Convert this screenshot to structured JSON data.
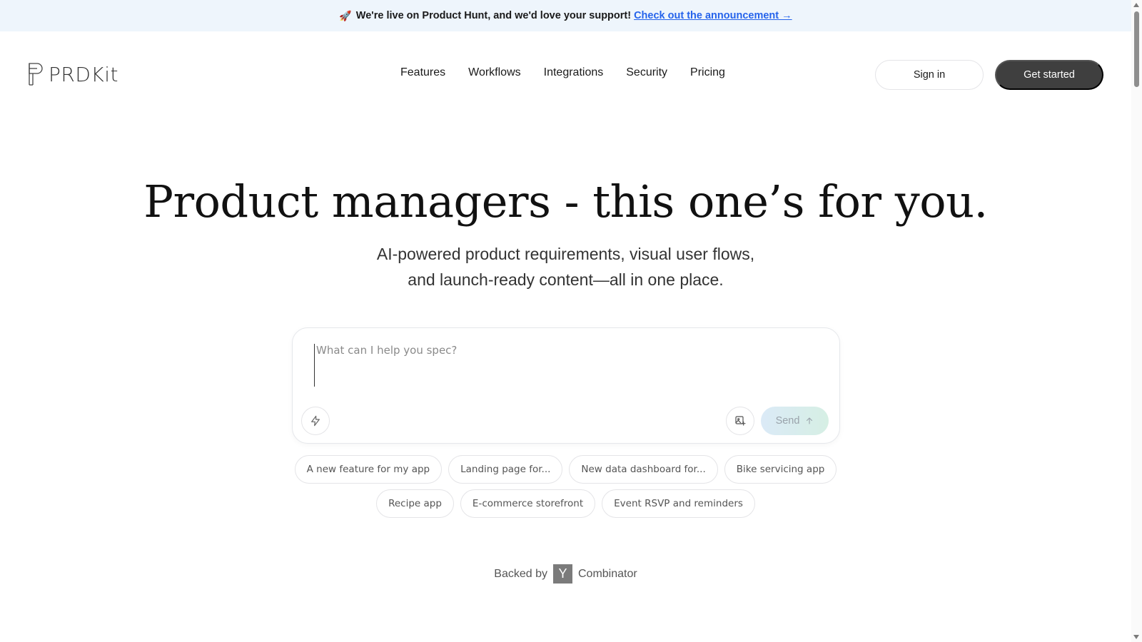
{
  "banner": {
    "text": "We're live on Product Hunt, and we'd love your support!",
    "link": "Check out the announcement →"
  },
  "header": {
    "logo": "PRDKit",
    "nav": [
      "Features",
      "Workflows",
      "Integrations",
      "Security",
      "Pricing"
    ],
    "sign_in": "Sign in",
    "get_started": "Get started"
  },
  "hero": {
    "title": "Product managers - this one’s for you.",
    "subtitle_line1": "AI-powered product requirements, visual user flows,",
    "subtitle_line2": "and launch-ready content—all in one place."
  },
  "prompt": {
    "placeholder": "What can I help you spec?",
    "send_label": "Send"
  },
  "suggestions": [
    "A new feature for my app",
    "Landing page for...",
    "New data dashboard for...",
    "Bike servicing app",
    "Recipe app",
    "E-commerce storefront",
    "Event RSVP and reminders"
  ],
  "backed": {
    "prefix": "Backed by",
    "logo_letter": "Y",
    "name": "Combinator"
  },
  "icons": {
    "banner": "rocket-icon",
    "logo": "prdkit-logo-icon",
    "quick": "lightning-icon",
    "attach": "image-add-icon",
    "send": "arrow-up-icon"
  },
  "colors": {
    "banner_bg": "#eef5fc",
    "link": "#2563eb",
    "primary_button": "#3f3f3f"
  }
}
